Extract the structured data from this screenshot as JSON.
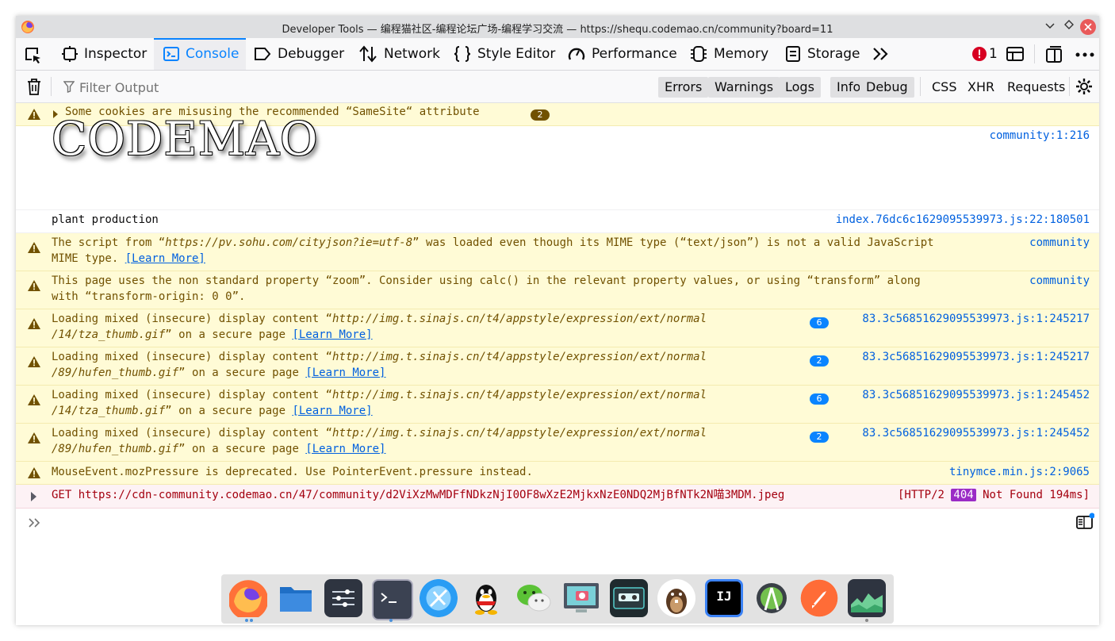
{
  "window": {
    "title": "Developer Tools — 编程猫社区-编程论坛广场-编程学习交流 — https://shequ.codemao.cn/community?board=11"
  },
  "toolbar": {
    "tabs": [
      {
        "label": "Inspector",
        "icon": "inspector-icon"
      },
      {
        "label": "Console",
        "icon": "console-icon",
        "active": true
      },
      {
        "label": "Debugger",
        "icon": "debugger-icon"
      },
      {
        "label": "Network",
        "icon": "network-icon"
      },
      {
        "label": "Style Editor",
        "icon": "style-editor-icon"
      },
      {
        "label": "Performance",
        "icon": "performance-icon"
      },
      {
        "label": "Memory",
        "icon": "memory-icon"
      },
      {
        "label": "Storage",
        "icon": "storage-icon"
      }
    ],
    "error_count": "1",
    "accent_color": "#0a84ff"
  },
  "filterbar": {
    "placeholder": "Filter Output",
    "levels": [
      "Errors",
      "Warnings",
      "Logs",
      "Info",
      "Debug"
    ],
    "categories": [
      "CSS",
      "XHR",
      "Requests"
    ]
  },
  "messages": [
    {
      "type": "warn",
      "text": "Some cookies are misusing the recommended “SameSite“ attribute",
      "count": "2"
    },
    {
      "type": "log",
      "logo_text": "CODEMAO",
      "source": "community:1:216"
    },
    {
      "type": "log",
      "text": "plant production",
      "source": "index.76dc6c1629095539973.js:22:180501"
    },
    {
      "type": "warn",
      "line1_a": "The script from “",
      "line1_url": "https://pv.sohu.com/cityjson?ie=utf-8",
      "line1_b": "” was loaded even though its MIME type (“text/json”) is not a valid JavaScript",
      "line2": "MIME type. ",
      "learn": "[Learn More]",
      "source": "community"
    },
    {
      "type": "warn",
      "line1": "This page uses the non standard property “zoom”. Consider using calc() in the relevant property values, or using “transform” along",
      "line2": "with “transform-origin: 0 0”.",
      "source": "community"
    },
    {
      "type": "warn",
      "line1_a": "Loading mixed (insecure) display content “",
      "line1_url": "http://img.t.sinajs.cn/t4/appstyle/expression/ext/normal",
      "line2_url": "/14/tza_thumb.gif",
      "line2_b": "” on a secure page ",
      "learn": "[Learn More]",
      "count": "6",
      "source": "83.3c56851629095539973.js:1:245217"
    },
    {
      "type": "warn",
      "line1_a": "Loading mixed (insecure) display content “",
      "line1_url": "http://img.t.sinajs.cn/t4/appstyle/expression/ext/normal",
      "line2_url": "/89/hufen_thumb.gif",
      "line2_b": "” on a secure page ",
      "learn": "[Learn More]",
      "count": "2",
      "source": "83.3c56851629095539973.js:1:245217"
    },
    {
      "type": "warn",
      "line1_a": "Loading mixed (insecure) display content “",
      "line1_url": "http://img.t.sinajs.cn/t4/appstyle/expression/ext/normal",
      "line2_url": "/14/tza_thumb.gif",
      "line2_b": "” on a secure page ",
      "learn": "[Learn More]",
      "count": "6",
      "source": "83.3c56851629095539973.js:1:245452"
    },
    {
      "type": "warn",
      "line1_a": "Loading mixed (insecure) display content “",
      "line1_url": "http://img.t.sinajs.cn/t4/appstyle/expression/ext/normal",
      "line2_url": "/89/hufen_thumb.gif",
      "line2_b": "” on a secure page ",
      "learn": "[Learn More]",
      "count": "2",
      "source": "83.3c56851629095539973.js:1:245452"
    },
    {
      "type": "warn",
      "text": "MouseEvent.mozPressure is deprecated. Use PointerEvent.pressure instead.",
      "source": "tinymce.min.js:2:9065"
    },
    {
      "type": "error",
      "text": "GET https://cdn-community.codemao.cn/47/community/d2ViXzMwMDFfNDkzNjI0OF8wXzE2MjkxNzE0NDQ2MjBfNTk2N喵3MDM.jpeg",
      "status_a": "[HTTP/2 ",
      "status_code": "404",
      "status_b": " Not Found 194ms]"
    }
  ],
  "dock": {
    "apps": [
      "firefox-icon",
      "files-icon",
      "settings-icon",
      "terminal-icon",
      "browser-icon",
      "qq-icon",
      "wechat-icon",
      "screenshot-icon",
      "cassette-icon",
      "beaver-icon",
      "intellij-icon",
      "android-studio-icon",
      "postman-icon",
      "system-monitor-icon"
    ],
    "intellij_label": "IJ"
  }
}
